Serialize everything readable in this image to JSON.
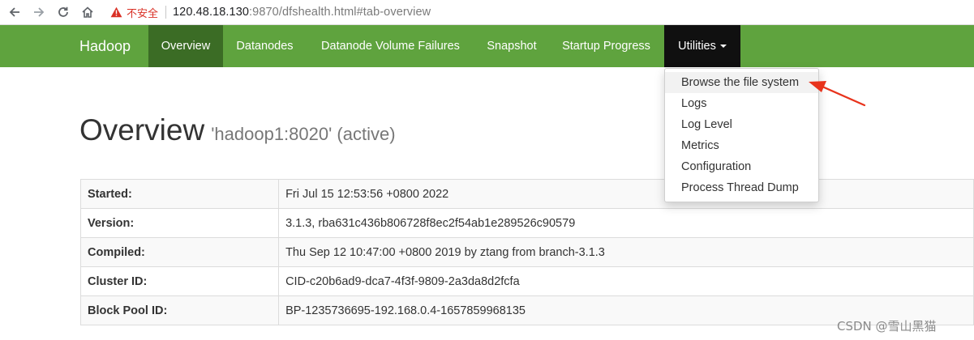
{
  "browser": {
    "security_label": "不安全",
    "url_host": "120.48.18.130",
    "url_rest": ":9870/dfshealth.html#tab-overview"
  },
  "navbar": {
    "brand": "Hadoop",
    "items": [
      {
        "label": "Overview"
      },
      {
        "label": "Datanodes"
      },
      {
        "label": "Datanode Volume Failures"
      },
      {
        "label": "Snapshot"
      },
      {
        "label": "Startup Progress"
      },
      {
        "label": "Utilities"
      }
    ]
  },
  "utilities_menu": {
    "items": [
      {
        "label": "Browse the file system"
      },
      {
        "label": "Logs"
      },
      {
        "label": "Log Level"
      },
      {
        "label": "Metrics"
      },
      {
        "label": "Configuration"
      },
      {
        "label": "Process Thread Dump"
      }
    ]
  },
  "overview": {
    "title": "Overview",
    "subtitle": "'hadoop1:8020' (active)",
    "rows": [
      {
        "key": "Started:",
        "value": "Fri Jul 15 12:53:56 +0800 2022"
      },
      {
        "key": "Version:",
        "value": "3.1.3, rba631c436b806728f8ec2f54ab1e289526c90579"
      },
      {
        "key": "Compiled:",
        "value": "Thu Sep 12 10:47:00 +0800 2019 by ztang from branch-3.1.3"
      },
      {
        "key": "Cluster ID:",
        "value": "CID-c20b6ad9-dca7-4f3f-9809-2a3da8d2fcfa"
      },
      {
        "key": "Block Pool ID:",
        "value": "BP-1235736695-192.168.0.4-1657859968135"
      }
    ]
  },
  "watermark": "CSDN @雪山黑猫",
  "colors": {
    "navbar": "#5fa33e",
    "nav_active": "#3b6c25",
    "dropdown_toggle_open": "#101010",
    "annotation_arrow": "#e8331c",
    "security_warning": "#d93025"
  },
  "icons": [
    "back-arrow-icon",
    "forward-arrow-icon",
    "reload-icon",
    "home-icon",
    "warning-icon",
    "caret-down-icon"
  ]
}
